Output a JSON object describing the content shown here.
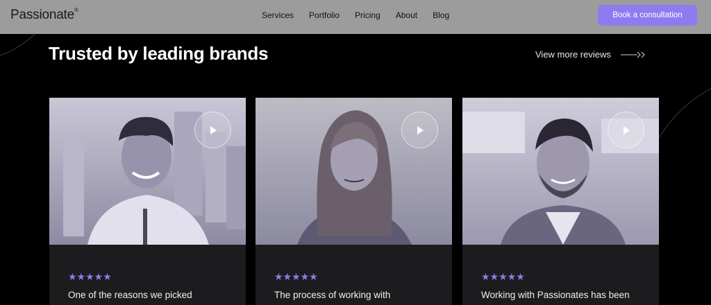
{
  "header": {
    "logo": "Passionate",
    "logo_mark": "®",
    "nav": [
      "Services",
      "Portfolio",
      "Pricing",
      "About",
      "Blog"
    ],
    "cta_label": "Book a consultation"
  },
  "section": {
    "title": "Trusted by leading brands",
    "more_label": "View more reviews",
    "more_icon": "arrow-right-icon"
  },
  "testimonials": [
    {
      "rating": 5,
      "stars": "★★★★★",
      "quote": "One of the reasons we picked",
      "play_icon": "play-icon"
    },
    {
      "rating": 5,
      "stars": "★★★★★",
      "quote": "The process of working with",
      "play_icon": "play-icon"
    },
    {
      "rating": 5,
      "stars": "★★★★★",
      "quote": "Working with Passionates has been",
      "play_icon": "play-icon"
    }
  ],
  "colors": {
    "accent": "#8f7bf0",
    "header_bg": "#9c9c9c",
    "page_bg": "#000000",
    "card_bg": "#1c1c1e"
  }
}
